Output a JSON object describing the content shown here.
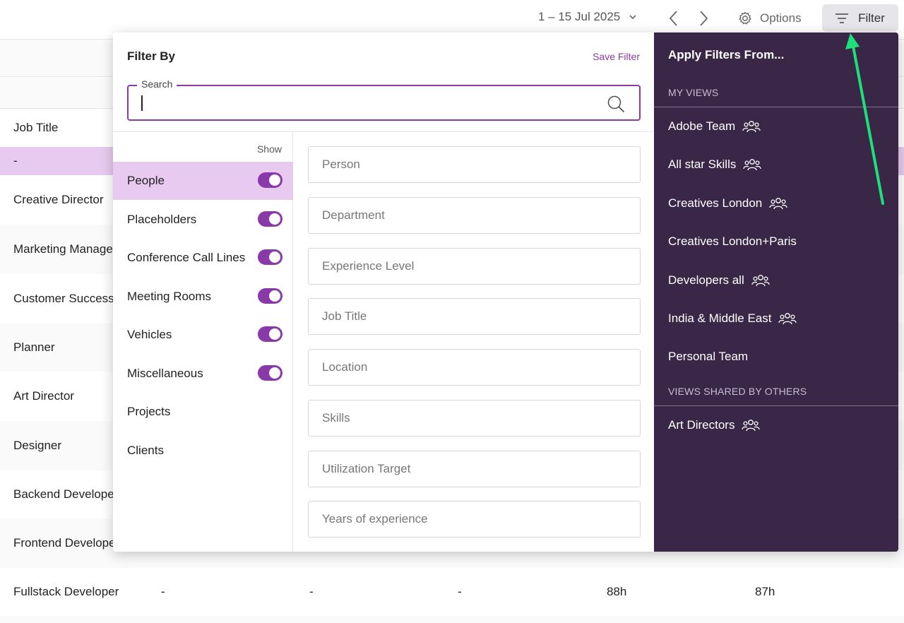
{
  "topbar": {
    "date_range": "1 – 15 Jul 2025",
    "options_label": "Options",
    "filter_label": "Filter"
  },
  "table": {
    "job_title_header": "Job Title",
    "rows": [
      {
        "label": "-"
      },
      {
        "label": "Creative Director"
      },
      {
        "label": "Marketing Manage"
      },
      {
        "label": "Customer Success"
      },
      {
        "label": "Planner"
      },
      {
        "label": "Art Director"
      },
      {
        "label": "Designer"
      },
      {
        "label": "Backend Develope"
      },
      {
        "label": "Frontend Develope"
      },
      {
        "label": "Fullstack Developer",
        "cells": [
          "-",
          "-",
          "-",
          "88h",
          "87h"
        ]
      }
    ]
  },
  "filter_panel": {
    "title": "Filter By",
    "save_label": "Save Filter",
    "search_label": "Search",
    "show_label": "Show",
    "types": [
      {
        "label": "People",
        "toggle": true,
        "active": true
      },
      {
        "label": "Placeholders",
        "toggle": true
      },
      {
        "label": "Conference Call Lines",
        "toggle": true
      },
      {
        "label": "Meeting Rooms",
        "toggle": true
      },
      {
        "label": "Vehicles",
        "toggle": true
      },
      {
        "label": "Miscellaneous",
        "toggle": true
      },
      {
        "label": "Projects",
        "toggle": false
      },
      {
        "label": "Clients",
        "toggle": false
      }
    ],
    "fields": [
      "Person",
      "Department",
      "Experience Level",
      "Job Title",
      "Location",
      "Skills",
      "Utilization Target",
      "Years of experience"
    ]
  },
  "saved_views": {
    "title": "Apply Filters From...",
    "my_views_heading": "MY VIEWS",
    "my_views": [
      {
        "label": "Adobe Team",
        "shared": true
      },
      {
        "label": "All star Skills",
        "shared": true
      },
      {
        "label": "Creatives London",
        "shared": true
      },
      {
        "label": "Creatives London+Paris",
        "shared": false
      },
      {
        "label": "Developers all",
        "shared": true
      },
      {
        "label": "India & Middle East",
        "shared": true
      },
      {
        "label": "Personal Team",
        "shared": false
      }
    ],
    "shared_heading": "VIEWS SHARED BY OTHERS",
    "shared_views": [
      {
        "label": "Art Directors",
        "shared": true
      }
    ]
  },
  "colors": {
    "accent": "#8a3aa8",
    "sidebar_bg": "#3a2747",
    "selected_row": "#e8c9ef",
    "annotation_arrow": "#1ee07a"
  }
}
